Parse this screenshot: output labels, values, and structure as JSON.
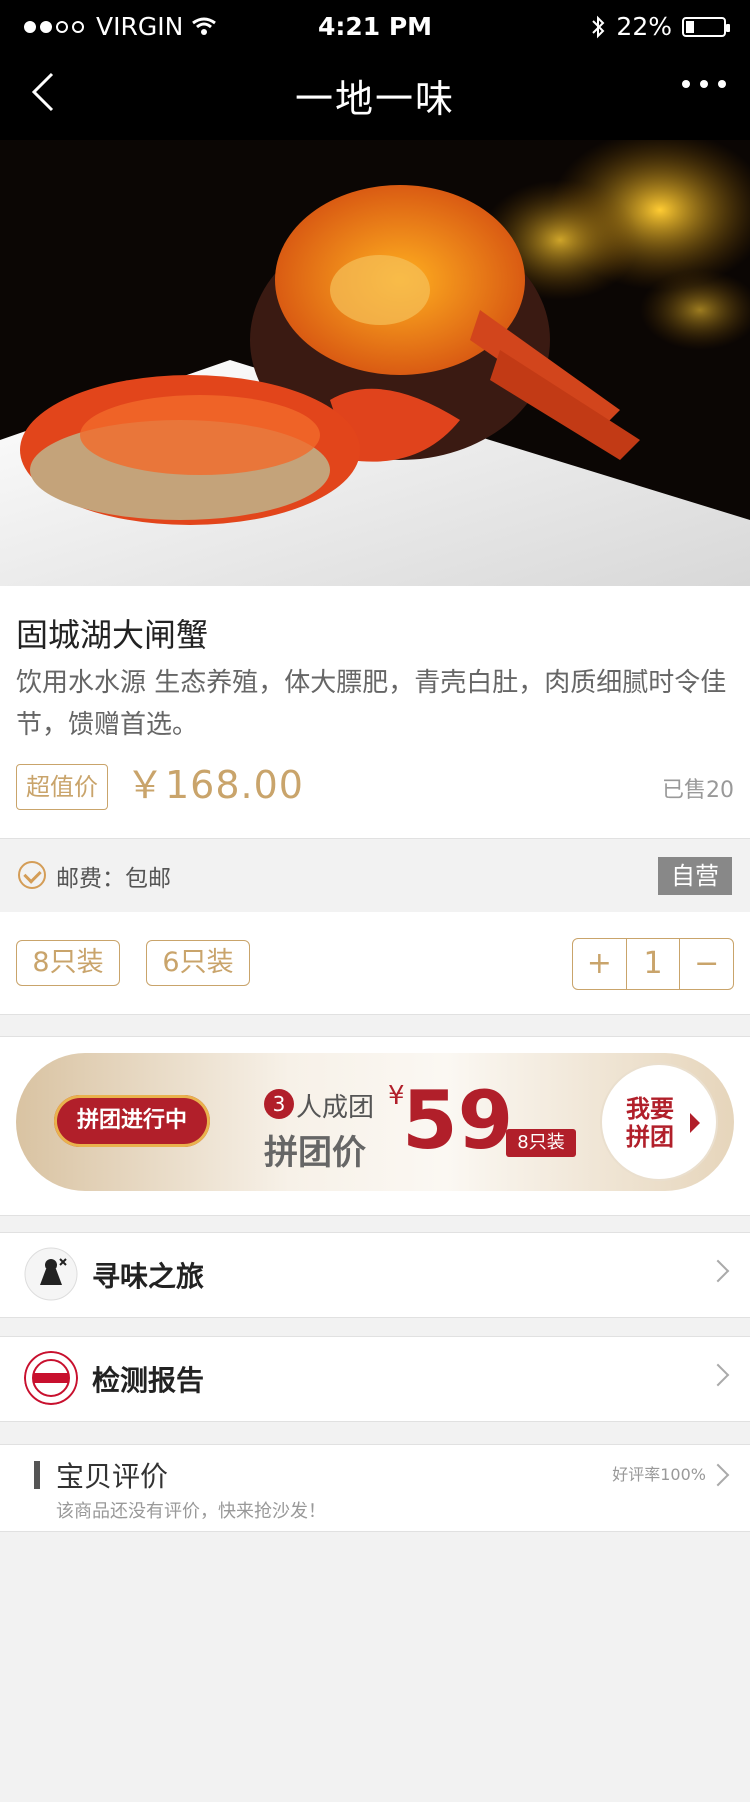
{
  "status_bar": {
    "carrier": "VIRGIN",
    "time": "4:21 PM",
    "battery": "22%",
    "battery_level": 0.22,
    "icons": [
      "signal-dots-icon",
      "wifi-icon",
      "bluetooth-icon",
      "battery-icon"
    ]
  },
  "nav": {
    "title": "一地一味",
    "back_icon": "chevron-left-icon",
    "more_icon": "more-dots-icon"
  },
  "product": {
    "title": "固城湖大闸蟹",
    "description": "饮用水水源 生态养殖，体大膘肥，青壳白肚，肉质细腻时令佳节，馈赠首选。",
    "price_tag": "超值价",
    "price": "￥168.00",
    "sold": "已售20"
  },
  "shipping": {
    "label": "邮费：包邮",
    "badge": "自营"
  },
  "options": {
    "items": [
      "8只装",
      "6只装"
    ],
    "stepper": {
      "plus": "+",
      "qty": "1",
      "minus": "−"
    }
  },
  "group_buy": {
    "status": "拼团进行中",
    "people_count": "3",
    "people_text": "人成团",
    "price_label": "拼团价",
    "currency": "¥",
    "price": "59",
    "pack": "8只装",
    "cta": "我要拼团"
  },
  "rows": [
    {
      "label": "寻味之旅",
      "icon": "chef-logo-icon"
    },
    {
      "label": "检测报告",
      "icon": "test-seal-icon"
    }
  ],
  "reviews": {
    "title": "宝贝评价",
    "empty": "该商品还没有评价，快来抢沙发！",
    "rate": "好评率100%"
  },
  "colors": {
    "accent_gold": "#c9a46b",
    "group_red": "#b11f2a",
    "background": "#f2f2f2"
  }
}
